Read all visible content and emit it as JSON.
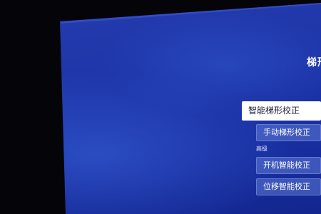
{
  "panel": {
    "title": "梯形"
  },
  "menu": {
    "smart_keystone": "智能梯形校正",
    "manual_keystone": "手动梯形校正",
    "advanced_section": "高级",
    "boot_smart_correction": "开机智能校正",
    "displacement_smart_correction": "位移智能校正"
  },
  "colors": {
    "screen_blue": "#1d35a8",
    "selected_bg": "#ffffff",
    "item_bg": "#6e8ce1"
  }
}
